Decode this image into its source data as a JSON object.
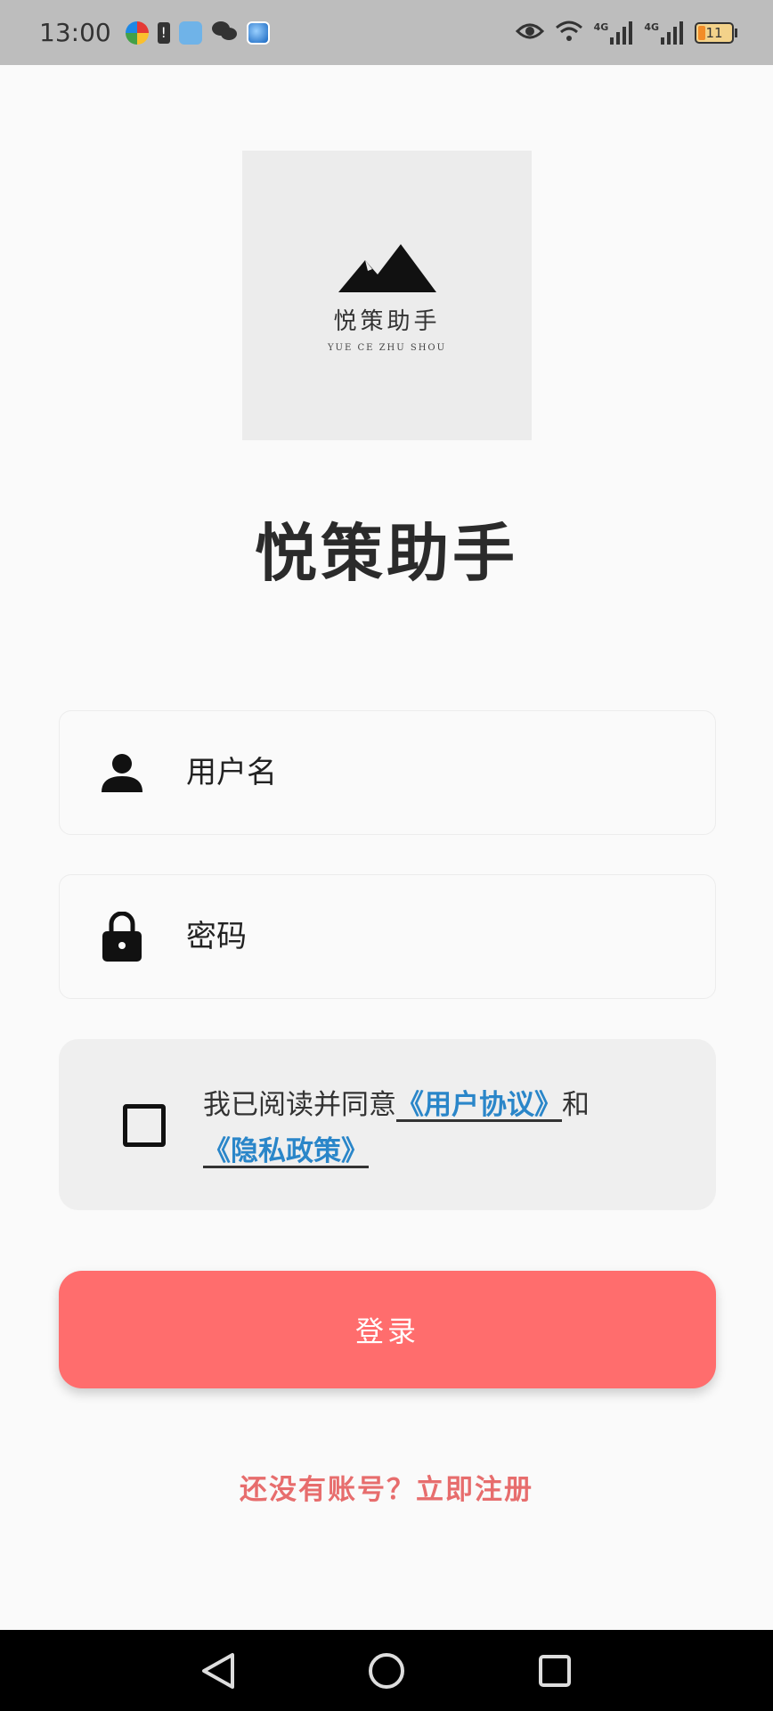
{
  "status_bar": {
    "time": "13:00",
    "network_1": "4G",
    "network_2": "4G",
    "battery": "11"
  },
  "logo": {
    "name_cn": "悦策助手",
    "name_en": "YUE CE ZHU SHOU"
  },
  "app_title": "悦策助手",
  "username_field": {
    "placeholder": "用户名",
    "icon": "user-icon"
  },
  "password_field": {
    "placeholder": "密码",
    "icon": "lock-icon"
  },
  "agreement": {
    "prefix": "我已阅读并同意",
    "user_agreement": "《用户协议》",
    "conjunction": "和",
    "privacy_policy": "《隐私政策》",
    "checked": false
  },
  "login_button": "登录",
  "register_link": "还没有账号？立即注册",
  "colors": {
    "primary": "#ff6d6d",
    "link": "#2a86c9",
    "register": "#e76d6d"
  }
}
